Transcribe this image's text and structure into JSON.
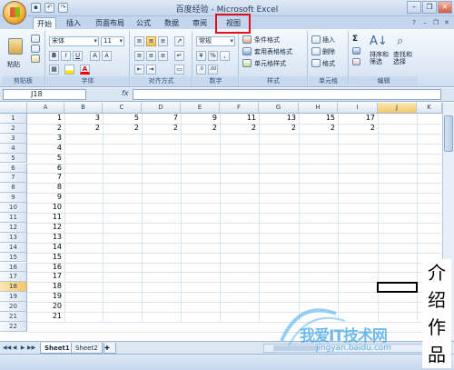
{
  "window": {
    "title": "百度经验 - Microsoft Excel",
    "qat": [
      "save-icon",
      "undo-icon",
      "redo-icon"
    ],
    "controls": [
      "minimize",
      "restore",
      "close"
    ]
  },
  "tabs": [
    {
      "label": "开始",
      "active": true
    },
    {
      "label": "插入"
    },
    {
      "label": "页面布局"
    },
    {
      "label": "公式"
    },
    {
      "label": "数据"
    },
    {
      "label": "审阅"
    },
    {
      "label": "视图",
      "highlighted": true
    }
  ],
  "ribbon": {
    "clipboard": {
      "paste": "粘贴",
      "label": "剪贴板"
    },
    "font": {
      "name": "宋体",
      "size": "11",
      "label": "字体",
      "bold": "B",
      "italic": "I",
      "underline": "U",
      "grow": "A",
      "shrink": "A"
    },
    "alignment": {
      "label": "对齐方式"
    },
    "number": {
      "format": "常规",
      "label": "数字"
    },
    "styles": {
      "conditional": "条件格式",
      "table": "套用表格格式",
      "cell": "单元格样式",
      "label": "样式"
    },
    "cells": {
      "insert": "插入",
      "delete": "删除",
      "format": "格式",
      "label": "单元格"
    },
    "editing": {
      "sort": "排序和\n筛选",
      "find": "查找和\n选择",
      "label": "编辑"
    }
  },
  "formula_bar": {
    "name_box": "J18",
    "fx": "fx",
    "content": ""
  },
  "grid": {
    "columns": [
      "A",
      "B",
      "C",
      "D",
      "E",
      "F",
      "G",
      "H",
      "I",
      "J",
      "K"
    ],
    "rows": [
      "1",
      "2",
      "3",
      "4",
      "5",
      "6",
      "7",
      "8",
      "9",
      "10",
      "11",
      "12",
      "13",
      "14",
      "15",
      "16",
      "17",
      "18",
      "19",
      "20",
      "21",
      "22"
    ],
    "selected_cell": "J18",
    "row1": [
      "1",
      "3",
      "5",
      "7",
      "9",
      "11",
      "13",
      "15",
      "17"
    ],
    "row2": [
      "2",
      "2",
      "2",
      "2",
      "2",
      "2",
      "2",
      "2",
      "2"
    ],
    "colA_rows3_21": [
      "3",
      "4",
      "5",
      "6",
      "7",
      "8",
      "9",
      "10",
      "11",
      "12",
      "13",
      "14",
      "15",
      "16",
      "17",
      "18",
      "19",
      "20",
      "21"
    ]
  },
  "sheets": [
    "Sheet1",
    "Sheet2"
  ],
  "status": {
    "text": ""
  },
  "watermark": {
    "text": "我爱IT技术网",
    "url": "jingyan.baidu.com",
    "side_text": "介绍作品"
  }
}
